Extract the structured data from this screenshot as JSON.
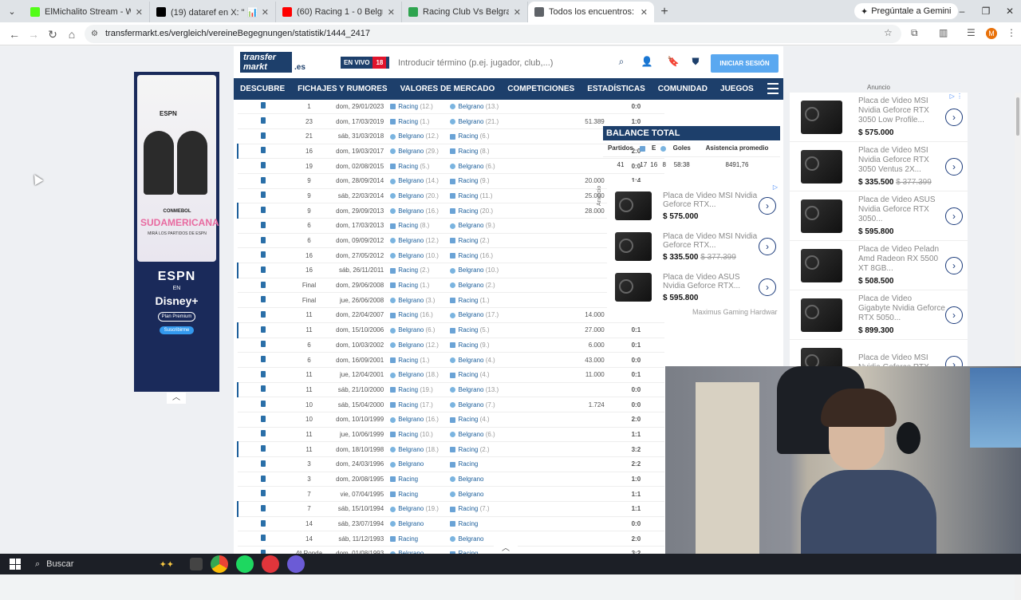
{
  "browser": {
    "tabs": [
      {
        "title": "ElMichalito Stream - Watch Live",
        "color": "#53fc18"
      },
      {
        "title": "(19) dataref en X: \" 📊 La PR",
        "color": "#000000"
      },
      {
        "title": "(60) Racing 1 - 0 Belgrano | Co",
        "color": "#ff0000"
      },
      {
        "title": "Racing Club Vs Belgrano - Aline",
        "color": "#2ea44f"
      },
      {
        "title": "Todos los encuentros: Racing C",
        "color": "#5f6368"
      }
    ],
    "gemini_label": "Pregúntale a Gemini",
    "url": "transfermarkt.es/vergleich/vereineBegegnungen/statistik/1444_2417",
    "profile_initial": "M"
  },
  "left_ad": {
    "network": "ESPN",
    "title": "SUDAMERICANA",
    "subtitle": "MIRÁ LOS PARTIDOS DE ESPN",
    "league": "CONMEBOL",
    "brand": "ESPN",
    "en": "EN",
    "disney": "Disney+",
    "plan": "Plan Premium",
    "cta": "Suscribirme"
  },
  "site": {
    "logo_line1": "transfer",
    "logo_line2": "markt",
    "domain_suffix": ".es",
    "live_label": "EN VIVO",
    "live_count": "18",
    "search_placeholder": "Introducir término (p.ej. jugador, club,...)",
    "login_label": "INICIAR SESIÓN",
    "nav": [
      "DESCUBRE",
      "FICHAJES Y RUMORES",
      "VALORES DE MERCADO",
      "COMPETICIONES",
      "ESTADÍSTICAS",
      "COMUNIDAD",
      "JUEGOS"
    ]
  },
  "matches": [
    {
      "md": "1",
      "date": "dom, 29/01/2023",
      "home": "Racing",
      "home_pos": "(12.)",
      "away": "Belgrano",
      "away_pos": "(13.)",
      "att": "",
      "res": "0:0",
      "type": "draw"
    },
    {
      "md": "23",
      "date": "dom, 17/03/2019",
      "home": "Racing",
      "home_pos": "(1.)",
      "away": "Belgrano",
      "away_pos": "(21.)",
      "att": "51.389",
      "res": "1:0",
      "type": "win"
    },
    {
      "md": "21",
      "date": "sáb, 31/03/2018",
      "home": "Belgrano",
      "home_pos": "(12.)",
      "away": "Racing",
      "away_pos": "(6.)",
      "att": "",
      "res": "2:2",
      "type": "draw"
    },
    {
      "md": "16",
      "date": "dom, 19/03/2017",
      "home": "Belgrano",
      "home_pos": "(29.)",
      "away": "Racing",
      "away_pos": "(8.)",
      "att": "",
      "res": "2:0",
      "type": "loss"
    },
    {
      "md": "19",
      "date": "dom, 02/08/2015",
      "home": "Racing",
      "home_pos": "(5.)",
      "away": "Belgrano",
      "away_pos": "(6.)",
      "att": "",
      "res": "0:0",
      "type": "draw"
    },
    {
      "md": "9",
      "date": "dom, 28/09/2014",
      "home": "Belgrano",
      "home_pos": "(14.)",
      "away": "Racing",
      "away_pos": "(9.)",
      "att": "20.000",
      "res": "1:4",
      "type": "win"
    },
    {
      "md": "9",
      "date": "sáb, 22/03/2014",
      "home": "Belgrano",
      "home_pos": "(20.)",
      "away": "Racing",
      "away_pos": "(11.)",
      "att": "25.000",
      "res": "2:0",
      "type": "loss"
    },
    {
      "md": "9",
      "date": "dom, 29/09/2013",
      "home": "Belgrano",
      "home_pos": "(16.)",
      "away": "Racing",
      "away_pos": "(20.)",
      "att": "28.000",
      "res": "3:0",
      "type": "loss"
    },
    {
      "md": "6",
      "date": "dom, 17/03/2013",
      "home": "Racing",
      "home_pos": "(8.)",
      "away": "Belgrano",
      "away_pos": "(9.)",
      "att": "",
      "res": "1:1",
      "type": "draw"
    },
    {
      "md": "6",
      "date": "dom, 09/09/2012",
      "home": "Belgrano",
      "home_pos": "(12.)",
      "away": "Racing",
      "away_pos": "(2.)",
      "att": "",
      "res": "1:0",
      "type": "loss"
    },
    {
      "md": "16",
      "date": "dom, 27/05/2012",
      "home": "Belgrano",
      "home_pos": "(10.)",
      "away": "Racing",
      "away_pos": "(16.)",
      "att": "",
      "res": "0:1",
      "type": "win"
    },
    {
      "md": "16",
      "date": "sáb, 26/11/2011",
      "home": "Racing",
      "home_pos": "(2.)",
      "away": "Belgrano",
      "away_pos": "(10.)",
      "att": "",
      "res": "2:3",
      "type": "loss"
    },
    {
      "md": "Final",
      "date": "dom, 29/06/2008",
      "home": "Racing",
      "home_pos": "(1.)",
      "away": "Belgrano",
      "away_pos": "(2.)",
      "att": "",
      "res": "1:0",
      "type": "win"
    },
    {
      "md": "Final",
      "date": "jue, 26/06/2008",
      "home": "Belgrano",
      "home_pos": "(3.)",
      "away": "Racing",
      "away_pos": "(1.)",
      "att": "",
      "res": "1:1",
      "type": "draw"
    },
    {
      "md": "11",
      "date": "dom, 22/04/2007",
      "home": "Racing",
      "home_pos": "(16.)",
      "away": "Belgrano",
      "away_pos": "(17.)",
      "att": "14.000",
      "res": "3:3",
      "type": "draw"
    },
    {
      "md": "11",
      "date": "dom, 15/10/2006",
      "home": "Belgrano",
      "home_pos": "(6.)",
      "away": "Racing",
      "away_pos": "(5.)",
      "att": "27.000",
      "res": "0:1",
      "type": "win"
    },
    {
      "md": "6",
      "date": "dom, 10/03/2002",
      "home": "Belgrano",
      "home_pos": "(12.)",
      "away": "Racing",
      "away_pos": "(9.)",
      "att": "6.000",
      "res": "0:1",
      "type": "win"
    },
    {
      "md": "6",
      "date": "dom, 16/09/2001",
      "home": "Racing",
      "home_pos": "(1.)",
      "away": "Belgrano",
      "away_pos": "(4.)",
      "att": "43.000",
      "res": "0:0",
      "type": "draw"
    },
    {
      "md": "11",
      "date": "jue, 12/04/2001",
      "home": "Belgrano",
      "home_pos": "(18.)",
      "away": "Racing",
      "away_pos": "(4.)",
      "att": "11.000",
      "res": "0:1",
      "type": "win"
    },
    {
      "md": "11",
      "date": "sáb, 21/10/2000",
      "home": "Racing",
      "home_pos": "(19.)",
      "away": "Belgrano",
      "away_pos": "(13.)",
      "att": "",
      "res": "0:0",
      "type": "draw"
    },
    {
      "md": "10",
      "date": "sáb, 15/04/2000",
      "home": "Racing",
      "home_pos": "(17.)",
      "away": "Belgrano",
      "away_pos": "(7.)",
      "att": "1.724",
      "res": "0:0",
      "type": "draw"
    },
    {
      "md": "10",
      "date": "dom, 10/10/1999",
      "home": "Belgrano",
      "home_pos": "(16.)",
      "away": "Racing",
      "away_pos": "(4.)",
      "att": "",
      "res": "2:0",
      "type": "loss"
    },
    {
      "md": "11",
      "date": "jue, 10/06/1999",
      "home": "Racing",
      "home_pos": "(10.)",
      "away": "Belgrano",
      "away_pos": "(6.)",
      "att": "",
      "res": "1:1",
      "type": "draw"
    },
    {
      "md": "11",
      "date": "dom, 18/10/1998",
      "home": "Belgrano",
      "home_pos": "(18.)",
      "away": "Racing",
      "away_pos": "(2.)",
      "att": "",
      "res": "3:2",
      "type": "loss"
    },
    {
      "md": "3",
      "date": "dom, 24/03/1996",
      "home": "Belgrano",
      "home_pos": "",
      "away": "Racing",
      "away_pos": "",
      "att": "",
      "res": "2:2",
      "type": "draw"
    },
    {
      "md": "3",
      "date": "dom, 20/08/1995",
      "home": "Racing",
      "home_pos": "",
      "away": "Belgrano",
      "away_pos": "",
      "att": "",
      "res": "1:0",
      "type": "win"
    },
    {
      "md": "7",
      "date": "vie, 07/04/1995",
      "home": "Racing",
      "home_pos": "",
      "away": "Belgrano",
      "away_pos": "",
      "att": "",
      "res": "1:1",
      "type": "draw"
    },
    {
      "md": "7",
      "date": "sáb, 15/10/1994",
      "home": "Belgrano",
      "home_pos": "(19.)",
      "away": "Racing",
      "away_pos": "(7.)",
      "att": "",
      "res": "1:1",
      "type": "draw"
    },
    {
      "md": "14",
      "date": "sáb, 23/07/1994",
      "home": "Belgrano",
      "home_pos": "",
      "away": "Racing",
      "away_pos": "",
      "att": "",
      "res": "0:0",
      "type": "draw"
    },
    {
      "md": "14",
      "date": "sáb, 11/12/1993",
      "home": "Racing",
      "home_pos": "",
      "away": "Belgrano",
      "away_pos": "",
      "att": "",
      "res": "2:0",
      "type": "win"
    },
    {
      "md": "4ª Ronda",
      "date": "dom, 01/08/1993",
      "home": "Belgrano",
      "home_pos": "",
      "away": "Racing",
      "away_pos": "",
      "att": "",
      "res": "3:2",
      "type": "loss"
    }
  ],
  "balance": {
    "title": "BALANCE TOTAL",
    "headers": [
      "Partidos",
      "",
      "E",
      "",
      "Goles",
      "Asistencia promedio"
    ],
    "values": [
      "41",
      "17",
      "16",
      "8",
      "58:38",
      "8491,76"
    ]
  },
  "inner_ad": {
    "label": "Anuncio",
    "footer": "Maximus Gaming Hardwar",
    "products": [
      {
        "name": "Placa de Video MSI Nvidia Geforce RTX...",
        "price": "$ 575.000",
        "old": ""
      },
      {
        "name": "Placa de Video MSI Nvidia Geforce RTX...",
        "price": "$ 335.500",
        "old": "$ 377.399"
      },
      {
        "name": "Placa de Video ASUS Nvidia Geforce RTX...",
        "price": "$ 595.800",
        "old": ""
      }
    ]
  },
  "right_ad": {
    "label": "Anuncio",
    "products": [
      {
        "name": "Placa de Video MSI Nvidia Geforce RTX 3050 Low Profile...",
        "price": "$ 575.000",
        "old": ""
      },
      {
        "name": "Placa de Video MSI Nvidia Geforce RTX 3050 Ventus 2X...",
        "price": "$ 335.500",
        "old": "$ 377.399"
      },
      {
        "name": "Placa de Video ASUS Nvidia Geforce RTX 3050...",
        "price": "$ 595.800",
        "old": ""
      },
      {
        "name": "Placa de Video Peladn Amd Radeon RX 5500 XT 8GB...",
        "price": "$ 508.500",
        "old": ""
      },
      {
        "name": "Placa de Video Gigabyte Nvidia Geforce RTX 5050...",
        "price": "$ 899.300",
        "old": ""
      },
      {
        "name": "Placa de Video MSI Nvidia Geforce RTX...",
        "price": "",
        "old": ""
      }
    ]
  },
  "taskbar": {
    "search_label": "Buscar"
  }
}
